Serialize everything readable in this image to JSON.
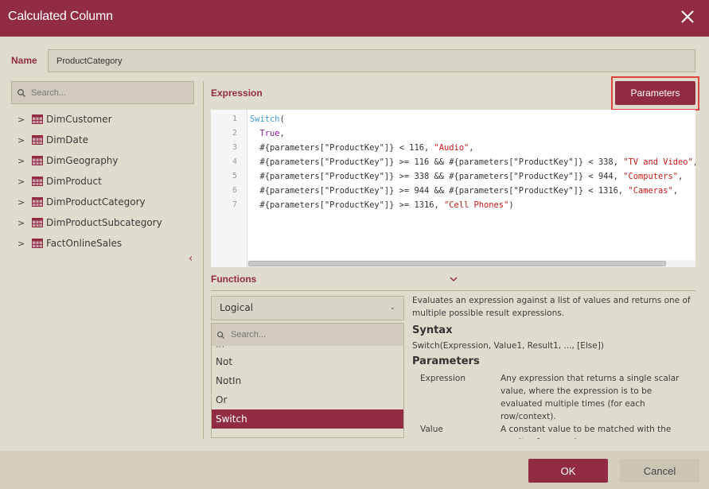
{
  "dialog": {
    "title": "Calculated Column",
    "close_icon": "close-icon"
  },
  "name_field": {
    "label": "Name",
    "value": "ProductCategory"
  },
  "tree": {
    "search_placeholder": "Search...",
    "items": [
      {
        "label": "DimCustomer"
      },
      {
        "label": "DimDate"
      },
      {
        "label": "DimGeography"
      },
      {
        "label": "DimProduct"
      },
      {
        "label": "DimProductCategory"
      },
      {
        "label": "DimProductSubcategory"
      },
      {
        "label": "FactOnlineSales"
      }
    ],
    "collapse_glyph": "‹"
  },
  "expression": {
    "label": "Expression",
    "parameters_button": "Parameters",
    "line_numbers": [
      "1",
      "2",
      "3",
      "4",
      "5",
      "6",
      "7"
    ],
    "lines": [
      [
        {
          "t": "kw",
          "v": "Switch"
        },
        {
          "t": "",
          "v": "("
        }
      ],
      [
        {
          "t": "",
          "v": "  "
        },
        {
          "t": "kw2",
          "v": "True"
        },
        {
          "t": "",
          "v": ","
        }
      ],
      [
        {
          "t": "",
          "v": "  #{parameters[\"ProductKey\"]} < 116, "
        },
        {
          "t": "str",
          "v": "\"Audio\""
        },
        {
          "t": "",
          "v": ","
        }
      ],
      [
        {
          "t": "",
          "v": "  #{parameters[\"ProductKey\"]} >= 116 && #{parameters[\"ProductKey\"]} < 338, "
        },
        {
          "t": "str",
          "v": "\"TV and Video\""
        },
        {
          "t": "",
          "v": ","
        }
      ],
      [
        {
          "t": "",
          "v": "  #{parameters[\"ProductKey\"]} >= 338 && #{parameters[\"ProductKey\"]} < 944, "
        },
        {
          "t": "str",
          "v": "\"Computers\""
        },
        {
          "t": "",
          "v": ","
        }
      ],
      [
        {
          "t": "",
          "v": "  #{parameters[\"ProductKey\"]} >= 944 && #{parameters[\"ProductKey\"]} < 1316, "
        },
        {
          "t": "str",
          "v": "\"Cameras\""
        },
        {
          "t": "",
          "v": ","
        }
      ],
      [
        {
          "t": "",
          "v": "  #{parameters[\"ProductKey\"]} >= 1316, "
        },
        {
          "t": "str",
          "v": "\"Cell Phones\""
        },
        {
          "t": "",
          "v": ")"
        }
      ]
    ]
  },
  "functions": {
    "label": "Functions",
    "category_selected": "Logical",
    "search_placeholder": "Search...",
    "items": [
      {
        "label": "In",
        "partial": true
      },
      {
        "label": "Not"
      },
      {
        "label": "NotIn"
      },
      {
        "label": "Or"
      },
      {
        "label": "Switch",
        "selected": true
      }
    ],
    "description": {
      "summary": "Evaluates an expression against a list of values and returns one of multiple possible result expressions.",
      "syntax_heading": "Syntax",
      "syntax": "Switch(Expression, Value1, Result1, ..., [Else])",
      "parameters_heading": "Parameters",
      "parameters": [
        {
          "name": "Expression",
          "desc": "Any expression that returns a single scalar value, where the expression is to be evaluated multiple times (for each row/context)."
        },
        {
          "name": "Value",
          "desc": "A constant value to be matched with the results of expression."
        }
      ]
    }
  },
  "footer": {
    "ok": "OK",
    "cancel": "Cancel"
  },
  "colors": {
    "accent": "#922c42",
    "background": "#dfdccd",
    "highlight_border": "#e0443f"
  }
}
